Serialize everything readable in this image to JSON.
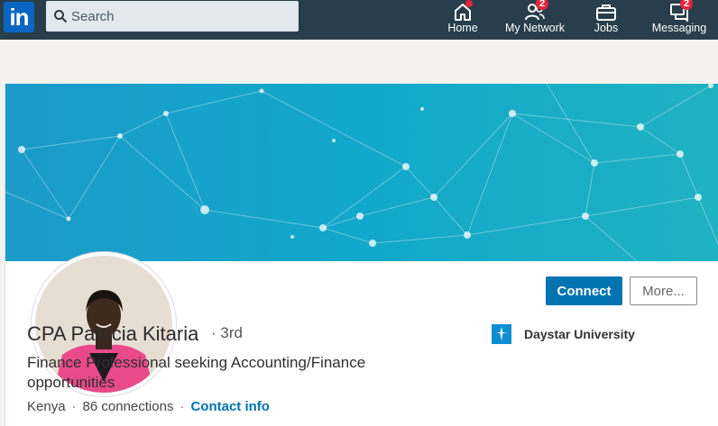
{
  "colors": {
    "topbar_bg": "#283e4a",
    "brand_blue": "#0a66c2",
    "connect_blue": "#0073b1",
    "badge_red": "#e6253b",
    "page_bg": "#f3f2ef"
  },
  "header": {
    "logo_text": "in",
    "search": {
      "placeholder": "Search",
      "value": ""
    },
    "nav": [
      {
        "label": "Home",
        "icon": "home-icon",
        "badge": ""
      },
      {
        "label": "My Network",
        "icon": "people-icon",
        "badge": "2"
      },
      {
        "label": "Jobs",
        "icon": "briefcase-icon",
        "badge": ""
      },
      {
        "label": "Messaging",
        "icon": "messaging-icon",
        "badge": "2"
      }
    ]
  },
  "profile": {
    "name": "CPA Patricia Kitaria",
    "degree": "· 3rd",
    "headline": "Finance Professional seeking Accounting/Finance opportunities",
    "location": "Kenya",
    "connections": "86 connections",
    "contact_info": "Contact info",
    "education": "Daystar University",
    "actions": {
      "connect": "Connect",
      "more": "More..."
    }
  }
}
